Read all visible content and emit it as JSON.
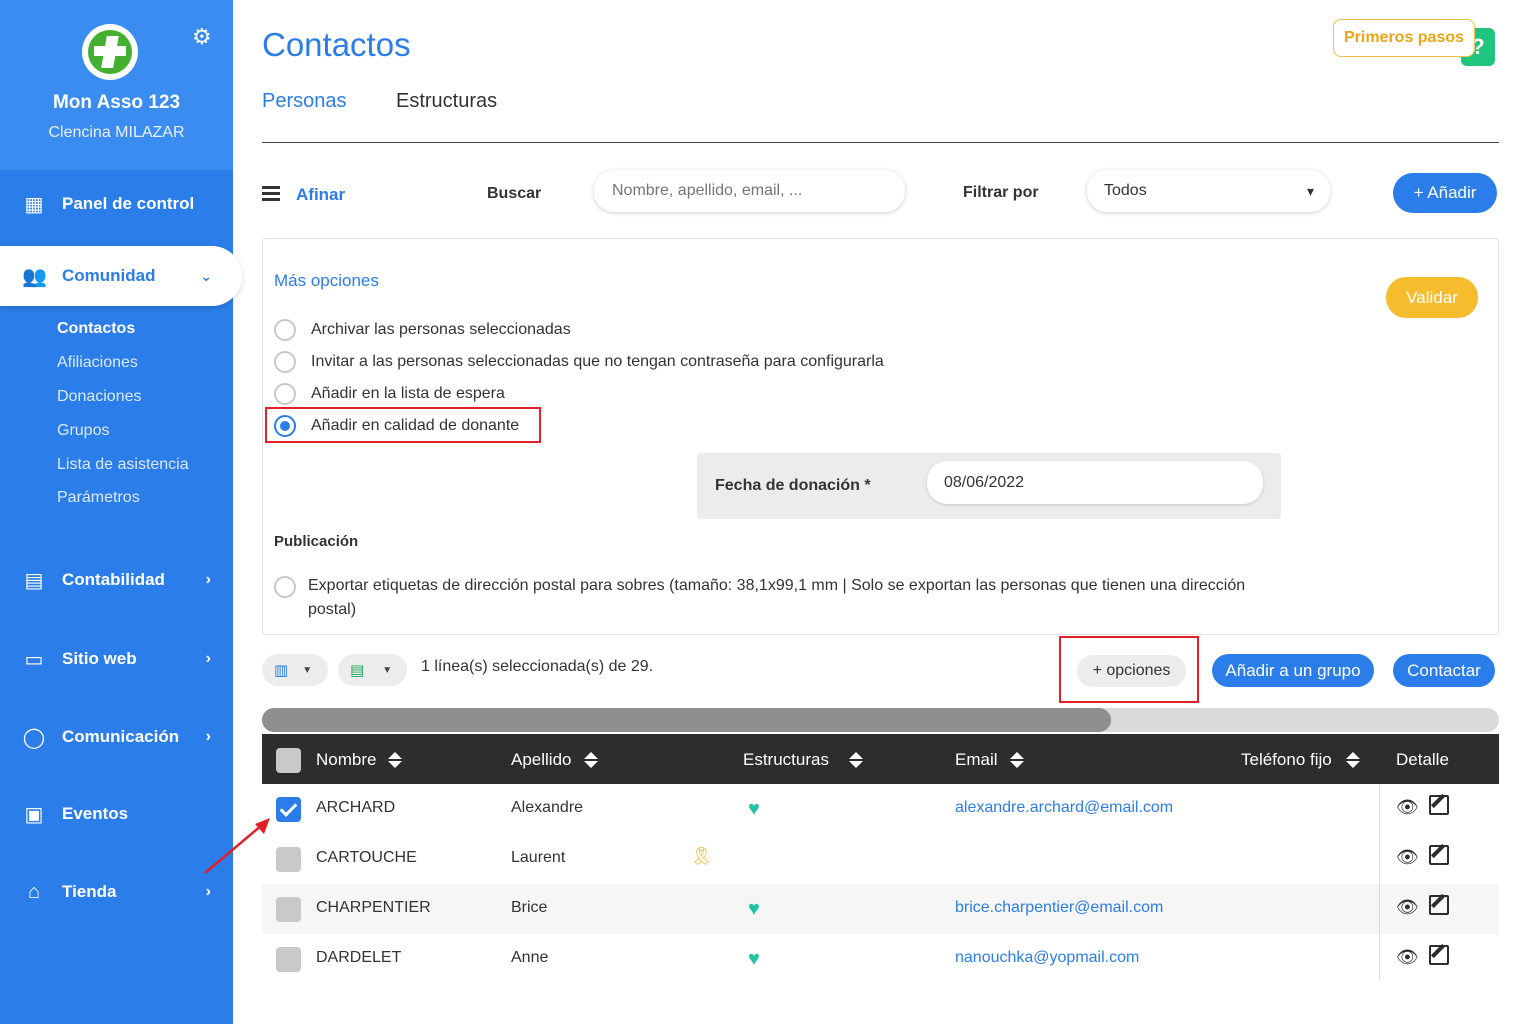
{
  "sidebar": {
    "org_name": "Mon Asso 123",
    "user_name": "Clencina MILAZAR",
    "nav": [
      {
        "label": "Panel de control",
        "icon": "dashboard-icon"
      },
      {
        "label": "Comunidad",
        "icon": "community-icon"
      },
      {
        "label": "Contabilidad",
        "icon": "calculator-icon"
      },
      {
        "label": "Sitio web",
        "icon": "monitor-icon"
      },
      {
        "label": "Comunicación",
        "icon": "chat-icon"
      },
      {
        "label": "Eventos",
        "icon": "calendar-icon"
      },
      {
        "label": "Tienda",
        "icon": "store-icon"
      }
    ],
    "sub_items": [
      "Contactos",
      "Afiliaciones",
      "Donaciones",
      "Grupos",
      "Lista de asistencia",
      "Parámetros"
    ]
  },
  "header": {
    "title": "Contactos",
    "first_steps": "Primeros pasos",
    "help": "?",
    "tabs": [
      "Personas",
      "Estructuras"
    ]
  },
  "toolbar": {
    "afinar": "Afinar",
    "buscar_label": "Buscar",
    "search_placeholder": "Nombre, apellido, email, ...",
    "filter_label": "Filtrar por",
    "filter_value": "Todos",
    "add_button": "+ Añadir"
  },
  "options": {
    "title": "Más opciones",
    "validar": "Validar",
    "radios": [
      {
        "label": "Archivar las personas seleccionadas",
        "checked": false
      },
      {
        "label": "Invitar a las personas seleccionadas que no tengan contraseña para configurarla",
        "checked": false
      },
      {
        "label": "Añadir en la lista de espera",
        "checked": false
      },
      {
        "label": "Añadir en calidad de donante",
        "checked": true
      }
    ],
    "fecha_label": "Fecha de donación *",
    "fecha_value": "08/06/2022",
    "publicacion": "Publicación",
    "export_label": "Exportar etiquetas de dirección postal para sobres (tamaño: 38,1x99,1 mm | Solo se exportan las personas que tienen una dirección postal)"
  },
  "actions": {
    "selection_info": "1 línea(s) seleccionada(s) de 29.",
    "more_options": "+ opciones",
    "add_to_group": "Añadir a un grupo",
    "contact": "Contactar"
  },
  "table": {
    "columns": [
      "Nombre",
      "Apellido",
      "Estructuras",
      "Email",
      "Teléfono fijo",
      "Detalle"
    ],
    "rows": [
      {
        "nombre": "ARCHARD",
        "apellido": "Alexandre",
        "marker": "heart",
        "email": "alexandre.archard@email.com",
        "checked": true
      },
      {
        "nombre": "CARTOUCHE",
        "apellido": "Laurent",
        "marker": "medal",
        "email": "",
        "checked": false
      },
      {
        "nombre": "CHARPENTIER",
        "apellido": "Brice",
        "marker": "heart",
        "email": "brice.charpentier@email.com",
        "checked": false
      },
      {
        "nombre": "DARDELET",
        "apellido": "Anne",
        "marker": "heart",
        "email": "nanouchka@yopmail.com",
        "checked": false
      }
    ]
  },
  "colors": {
    "primary": "#2b7de9",
    "accent": "#f5bd2e",
    "highlight": "#e2202a",
    "success": "#1fc5a3"
  }
}
